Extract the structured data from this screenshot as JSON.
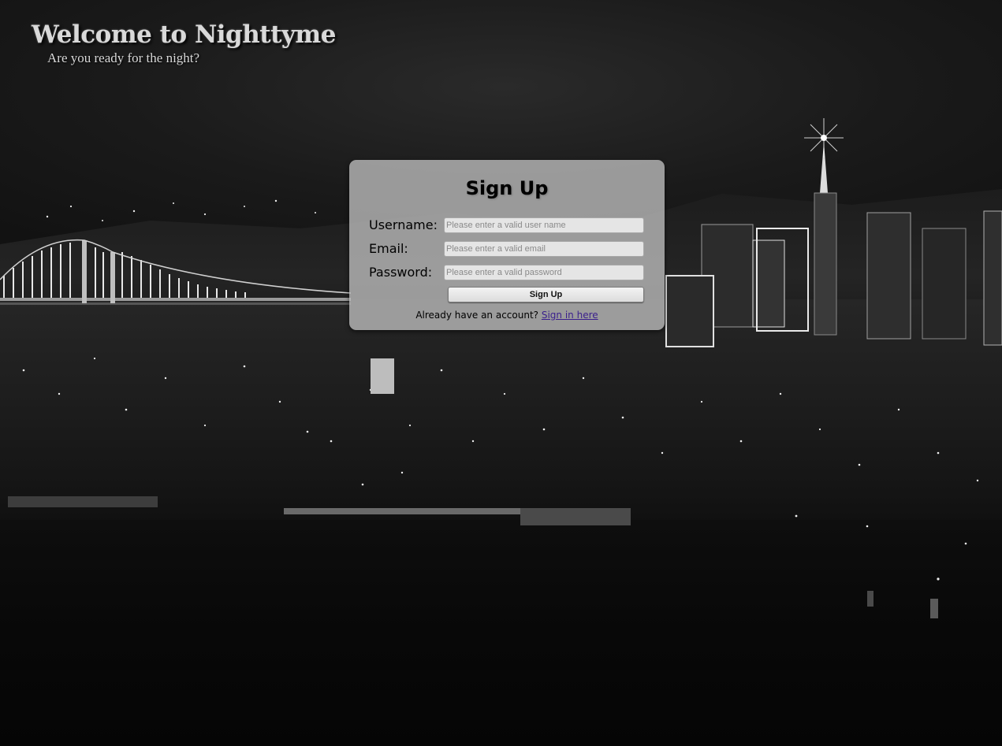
{
  "header": {
    "title": "Welcome to Nighttyme",
    "subtitle": "Are you ready for the night?"
  },
  "form": {
    "title": "Sign Up",
    "fields": [
      {
        "label": "Username:",
        "placeholder": "Please enter a valid user name",
        "value": ""
      },
      {
        "label": "Email:",
        "placeholder": "Please enter a valid email",
        "value": ""
      },
      {
        "label": "Password:",
        "placeholder": "Please enter a valid password",
        "value": ""
      }
    ],
    "submit_label": "Sign Up",
    "signin_prompt": "Already have an account?",
    "signin_link": "Sign in here"
  },
  "colors": {
    "panel": "#bababa",
    "link": "#3a1f8c",
    "title_text": "#d9d9d9"
  },
  "background": {
    "icon": "night-city-skyline-image"
  }
}
